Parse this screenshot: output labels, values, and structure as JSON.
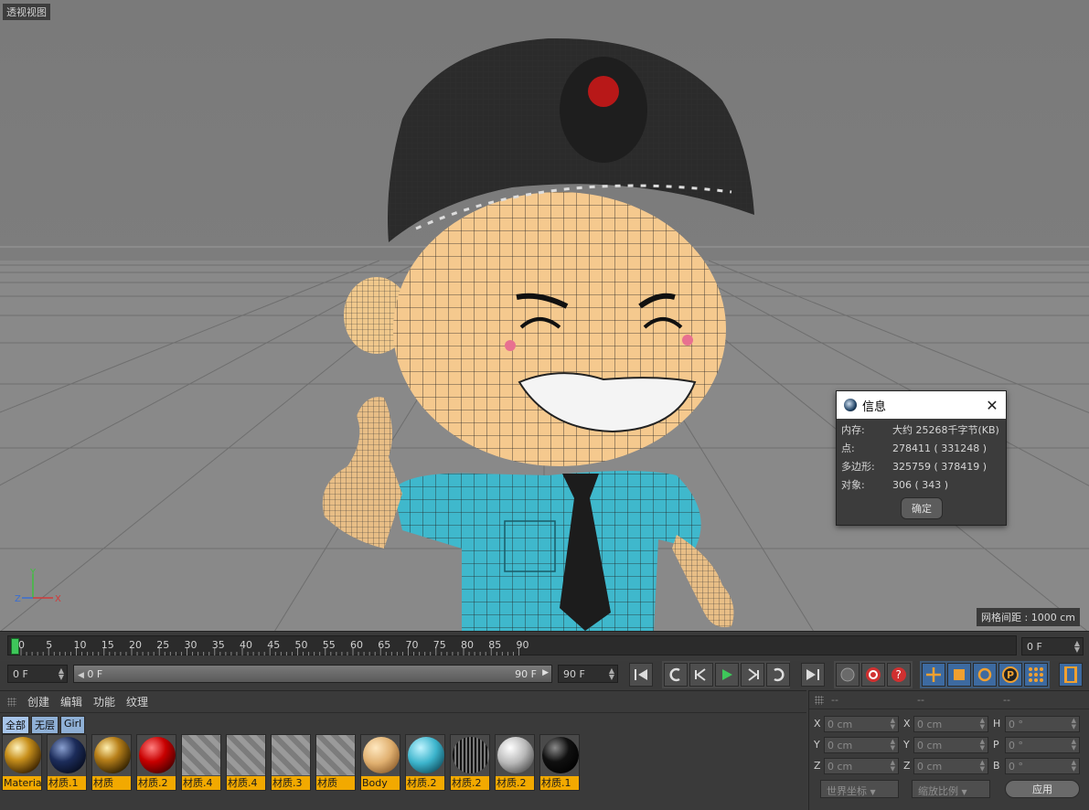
{
  "viewport": {
    "label": "透视视图",
    "grid_spacing": "网格间距 : 1000 cm",
    "axis": {
      "x": "X",
      "y": "Y",
      "z": "Z"
    }
  },
  "info_dialog": {
    "title": "信息",
    "rows": [
      {
        "key": "内存:",
        "value": "大约 25268千字节(KB)"
      },
      {
        "key": "点:",
        "value": "278411 ( 331248 )"
      },
      {
        "key": "多边形:",
        "value": "325759 ( 378419 )"
      },
      {
        "key": "对象:",
        "value": "306 ( 343 )"
      }
    ],
    "ok_label": "确定"
  },
  "timeline": {
    "ticks": [
      "0",
      "5",
      "10",
      "15",
      "20",
      "25",
      "30",
      "35",
      "40",
      "45",
      "50",
      "55",
      "60",
      "65",
      "70",
      "75",
      "80",
      "85",
      "90"
    ],
    "current_frame": "0 F",
    "start_frame": "0 F",
    "range_start": "0 F",
    "range_end": "90 F",
    "end_frame": "90 F"
  },
  "material_manager": {
    "menu": [
      "创建",
      "编辑",
      "功能",
      "纹理"
    ],
    "filters": [
      "全部",
      "无层",
      "Girl"
    ],
    "materials": [
      {
        "name": "Materia",
        "style": "gold"
      },
      {
        "name": "材质.1",
        "style": "navy"
      },
      {
        "name": "材质",
        "style": "gold2"
      },
      {
        "name": "材质.2",
        "style": "red"
      },
      {
        "name": "材质.4",
        "style": "tex"
      },
      {
        "name": "材质.4",
        "style": "tex"
      },
      {
        "name": "材质.3",
        "style": "tex-cube"
      },
      {
        "name": "材质",
        "style": "tex-face"
      },
      {
        "name": "Body",
        "style": "skin"
      },
      {
        "name": "材质.2",
        "style": "cyan"
      },
      {
        "name": "材质.2",
        "style": "stripe"
      },
      {
        "name": "材质.2",
        "style": "silver"
      },
      {
        "name": "材质.1",
        "style": "black"
      }
    ]
  },
  "coord_manager": {
    "headers": [
      "--",
      "--",
      "--"
    ],
    "pos_labels": [
      "X",
      "Y",
      "Z"
    ],
    "size_labels": [
      "X",
      "Y",
      "Z"
    ],
    "rot_labels": [
      "H",
      "P",
      "B"
    ],
    "pos_values": [
      "0 cm",
      "0 cm",
      "0 cm"
    ],
    "size_values": [
      "0 cm",
      "0 cm",
      "0 cm"
    ],
    "rot_values": [
      "0 °",
      "0 °",
      "0 °"
    ],
    "coord_mode": "世界坐标",
    "scale_mode": "缩放比例",
    "apply_label": "应用"
  }
}
